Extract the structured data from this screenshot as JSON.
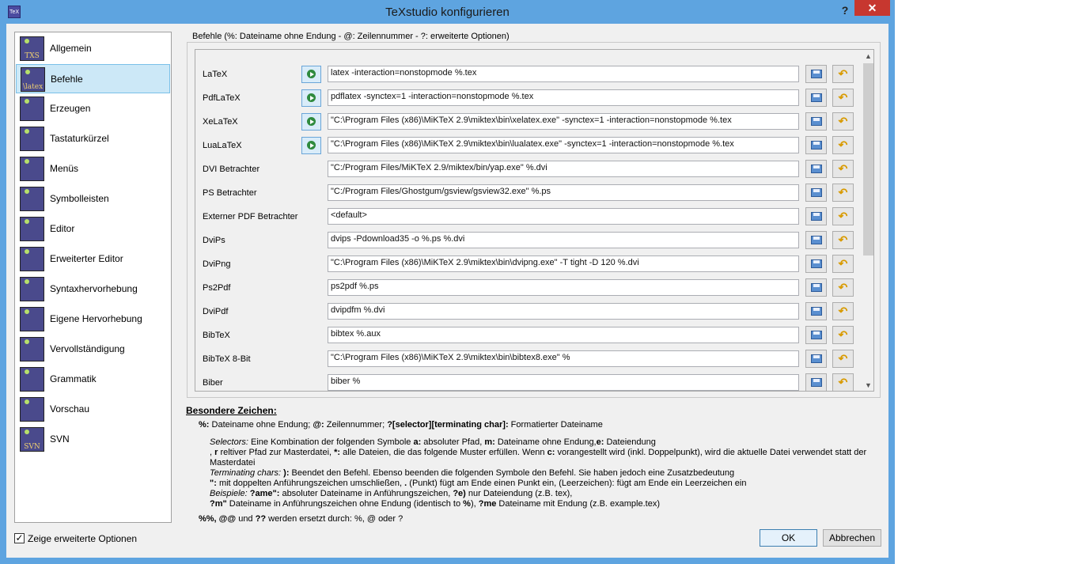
{
  "window": {
    "title": "TeXstudio konfigurieren",
    "app_icon_text": "TeX",
    "help_label": "?",
    "close_label": "✕"
  },
  "sidebar": {
    "items": [
      {
        "label": "Allgemein",
        "icon": "TXS"
      },
      {
        "label": "Befehle",
        "icon": "\\latex"
      },
      {
        "label": "Erzeugen",
        "icon": ""
      },
      {
        "label": "Tastaturkürzel",
        "icon": ""
      },
      {
        "label": "Menüs",
        "icon": ""
      },
      {
        "label": "Symbolleisten",
        "icon": ""
      },
      {
        "label": "Editor",
        "icon": ""
      },
      {
        "label": "Erweiterter Editor",
        "icon": ""
      },
      {
        "label": "Syntaxhervorhebung",
        "icon": ""
      },
      {
        "label": "Eigene Hervorhebung",
        "icon": ""
      },
      {
        "label": "Vervollständigung",
        "icon": ""
      },
      {
        "label": "Grammatik",
        "icon": ""
      },
      {
        "label": "Vorschau",
        "icon": ""
      },
      {
        "label": "SVN",
        "icon": "SVN"
      }
    ],
    "selected": "Befehle"
  },
  "advanced_checkbox": {
    "label": "Zeige erweiterte Optionen",
    "checked": true,
    "mark": "✓"
  },
  "commands": {
    "group_title": "Befehle (%: Dateiname ohne Endung - @: Zeilennummer - ?: erweiterte Optionen)",
    "reset_glyph": "↶",
    "scroll_up": "▲",
    "scroll_down": "▼",
    "rows": [
      {
        "label": "LaTeX",
        "value": "latex -interaction=nonstopmode %.tex",
        "has_run": true
      },
      {
        "label": "PdfLaTeX",
        "value": "pdflatex -synctex=1 -interaction=nonstopmode %.tex",
        "has_run": true
      },
      {
        "label": "XeLaTeX",
        "value": "\"C:\\Program Files (x86)\\MiKTeX 2.9\\miktex\\bin\\xelatex.exe\"  -synctex=1 -interaction=nonstopmode %.tex",
        "has_run": true
      },
      {
        "label": "LuaLaTeX",
        "value": "\"C:\\Program Files (x86)\\MiKTeX 2.9\\miktex\\bin\\lualatex.exe\"  -synctex=1 -interaction=nonstopmode %.tex",
        "has_run": true
      },
      {
        "label": "DVI Betrachter",
        "value": "\"C:/Program Files/MiKTeX 2.9/miktex/bin/yap.exe\" %.dvi",
        "has_run": false
      },
      {
        "label": "PS Betrachter",
        "value": "\"C:/Program Files/Ghostgum/gsview/gsview32.exe\" %.ps",
        "has_run": false
      },
      {
        "label": "Externer PDF Betrachter",
        "value": "<default>",
        "has_run": false
      },
      {
        "label": "DviPs",
        "value": "dvips -Pdownload35 -o %.ps %.dvi",
        "has_run": false
      },
      {
        "label": "DviPng",
        "value": "\"C:\\Program Files (x86)\\MiKTeX 2.9\\miktex\\bin\\dvipng.exe\"  -T tight -D 120 %.dvi",
        "has_run": false
      },
      {
        "label": "Ps2Pdf",
        "value": "ps2pdf %.ps",
        "has_run": false
      },
      {
        "label": "DviPdf",
        "value": "dvipdfm %.dvi",
        "has_run": false
      },
      {
        "label": "BibTeX",
        "value": "bibtex %.aux",
        "has_run": false
      },
      {
        "label": "BibTeX 8-Bit",
        "value": "\"C:\\Program Files (x86)\\MiKTeX 2.9\\miktex\\bin\\bibtex8.exe\"  %",
        "has_run": false
      },
      {
        "label": "Biber",
        "value": "biber %",
        "has_run": false
      }
    ]
  },
  "help": {
    "heading": "Besondere Zeichen:",
    "l1_a": "%:",
    "l1_b": " Dateiname ohne Endung; ",
    "l1_c": "@:",
    "l1_d": " Zeilennummer; ",
    "l1_e": "?[selector][terminating char]:",
    "l1_f": " Formatierter Dateiname",
    "l2_a": "Selectors:",
    "l2_b": " Eine Kombination der folgenden Symbole ",
    "l2_c": "a:",
    "l2_d": " absoluter Pfad, ",
    "l2_e": "m:",
    "l2_f": " Dateiname ohne Endung,",
    "l2_g": "e:",
    "l2_h": " Dateiendung",
    "l3_a": ", ",
    "l3_b": "r",
    "l3_c": " reltiver Pfad zur Masterdatei, ",
    "l3_d": "*:",
    "l3_e": " alle Dateien, die das folgende Muster erfüllen. Wenn ",
    "l3_f": "c:",
    "l3_g": " vorangestellt wird (inkl. Doppelpunkt), wird die aktuelle Datei verwendet statt der",
    "l4": "Masterdatei",
    "l5_a": "Terminating chars:",
    "l5_b": " ",
    "l5_c": "):",
    "l5_d": " Beendet den Befehl. Ebenso beenden die folgenden Symbole den Befehl. Sie haben jedoch eine Zusatzbedeutung",
    "l6_a": "\":",
    "l6_b": " mit doppelten Anführungszeichen umschließen, ",
    "l6_c": ".",
    "l6_d": " (Punkt) fügt am Ende einen Punkt ein, (Leerzeichen): fügt am Ende ein Leerzeichen ein",
    "l7_a": "Beispiele:",
    "l7_b": " ",
    "l7_c": "?ame\":",
    "l7_d": " absoluter Dateiname in Anführungszeichen, ",
    "l7_e": "?e)",
    "l7_f": " nur Dateiendung (z.B. tex),",
    "l8_a": "?m\"",
    "l8_b": " Dateiname in Anführungszeichen ohne Endung (identisch to ",
    "l8_c": "%",
    "l8_d": "), ",
    "l8_e": "?me",
    "l8_f": " Dateiname mit Endung (z.B. example.tex)",
    "l9_a": "%%, @@",
    "l9_b": " und ",
    "l9_c": "??",
    "l9_d": " werden ersetzt durch: %, @ oder ?"
  },
  "buttons": {
    "ok": "OK",
    "cancel": "Abbrechen"
  }
}
